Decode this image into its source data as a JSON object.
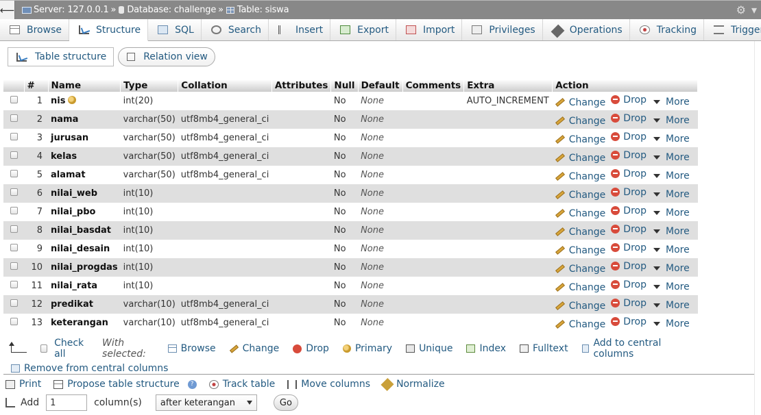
{
  "breadcrumb": {
    "server": "Server: 127.0.0.1",
    "database": "Database: challenge",
    "table": "Table: siswa",
    "sep": "»"
  },
  "tabs": [
    {
      "label": "Browse",
      "icon": "browse-icon"
    },
    {
      "label": "Structure",
      "icon": "structure-icon"
    },
    {
      "label": "SQL",
      "icon": "sql-icon"
    },
    {
      "label": "Search",
      "icon": "search-icon"
    },
    {
      "label": "Insert",
      "icon": "insert-icon"
    },
    {
      "label": "Export",
      "icon": "export-icon"
    },
    {
      "label": "Import",
      "icon": "import-icon"
    },
    {
      "label": "Privileges",
      "icon": "privileges-icon"
    },
    {
      "label": "Operations",
      "icon": "wrench-icon"
    },
    {
      "label": "Tracking",
      "icon": "eye-icon"
    },
    {
      "label": "Triggers",
      "icon": "triggers-icon"
    }
  ],
  "subtabs": {
    "structure": "Table structure",
    "relation": "Relation view"
  },
  "columns": {
    "num": "#",
    "name": "Name",
    "type": "Type",
    "collation": "Collation",
    "attributes": "Attributes",
    "null": "Null",
    "default": "Default",
    "comments": "Comments",
    "extra": "Extra",
    "action": "Action"
  },
  "actions": {
    "change": "Change",
    "drop": "Drop",
    "more": "More"
  },
  "rows": [
    {
      "num": "1",
      "name": "nis",
      "type": "int(20)",
      "collation": "",
      "null": "No",
      "default": "None",
      "extra": "AUTO_INCREMENT",
      "primary": true
    },
    {
      "num": "2",
      "name": "nama",
      "type": "varchar(50)",
      "collation": "utf8mb4_general_ci",
      "null": "No",
      "default": "None",
      "extra": ""
    },
    {
      "num": "3",
      "name": "jurusan",
      "type": "varchar(50)",
      "collation": "utf8mb4_general_ci",
      "null": "No",
      "default": "None",
      "extra": ""
    },
    {
      "num": "4",
      "name": "kelas",
      "type": "varchar(50)",
      "collation": "utf8mb4_general_ci",
      "null": "No",
      "default": "None",
      "extra": ""
    },
    {
      "num": "5",
      "name": "alamat",
      "type": "varchar(50)",
      "collation": "utf8mb4_general_ci",
      "null": "No",
      "default": "None",
      "extra": ""
    },
    {
      "num": "6",
      "name": "nilai_web",
      "type": "int(10)",
      "collation": "",
      "null": "No",
      "default": "None",
      "extra": ""
    },
    {
      "num": "7",
      "name": "nilai_pbo",
      "type": "int(10)",
      "collation": "",
      "null": "No",
      "default": "None",
      "extra": ""
    },
    {
      "num": "8",
      "name": "nilai_basdat",
      "type": "int(10)",
      "collation": "",
      "null": "No",
      "default": "None",
      "extra": ""
    },
    {
      "num": "9",
      "name": "nilai_desain",
      "type": "int(10)",
      "collation": "",
      "null": "No",
      "default": "None",
      "extra": ""
    },
    {
      "num": "10",
      "name": "nilai_progdas",
      "type": "int(10)",
      "collation": "",
      "null": "No",
      "default": "None",
      "extra": ""
    },
    {
      "num": "11",
      "name": "nilai_rata",
      "type": "int(10)",
      "collation": "",
      "null": "No",
      "default": "None",
      "extra": ""
    },
    {
      "num": "12",
      "name": "predikat",
      "type": "varchar(10)",
      "collation": "utf8mb4_general_ci",
      "null": "No",
      "default": "None",
      "extra": ""
    },
    {
      "num": "13",
      "name": "keterangan",
      "type": "varchar(10)",
      "collation": "utf8mb4_general_ci",
      "null": "No",
      "default": "None",
      "extra": ""
    }
  ],
  "bulk": {
    "check_all": "Check all",
    "with_selected": "With selected:",
    "browse": "Browse",
    "change": "Change",
    "drop": "Drop",
    "primary": "Primary",
    "unique": "Unique",
    "index": "Index",
    "fulltext": "Fulltext",
    "add_central": "Add to central columns",
    "remove_central": "Remove from central columns"
  },
  "footer": {
    "print": "Print",
    "propose": "Propose table structure",
    "track": "Track table",
    "move": "Move columns",
    "normalize": "Normalize",
    "add": "Add",
    "add_count": "1",
    "columns_label": "column(s)",
    "position": "after keterangan",
    "go": "Go"
  }
}
